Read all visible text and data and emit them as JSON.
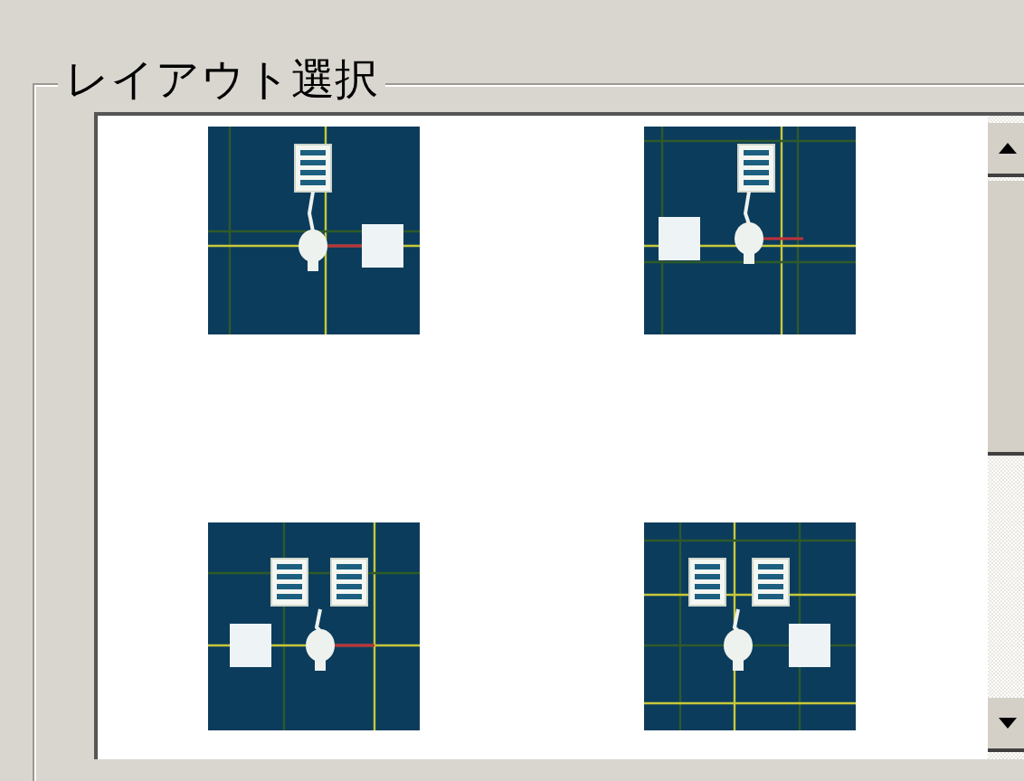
{
  "group": {
    "title": "レイアウト選択"
  },
  "layouts": [
    {
      "kind": "single_right"
    },
    {
      "kind": "single_left"
    },
    {
      "kind": "double_left"
    },
    {
      "kind": "double_right"
    }
  ]
}
